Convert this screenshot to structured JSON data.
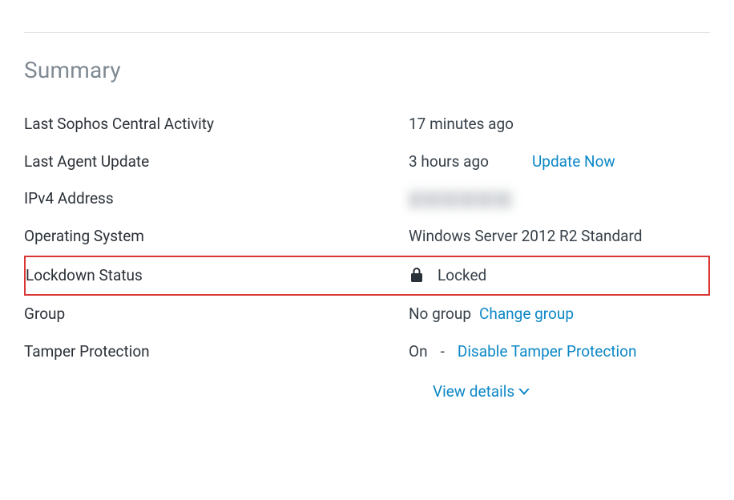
{
  "section_title": "Summary",
  "rows": {
    "activity": {
      "label": "Last Sophos Central Activity",
      "value": "17 minutes ago"
    },
    "agent_update": {
      "label": "Last Agent Update",
      "value": "3 hours ago",
      "action": "Update Now"
    },
    "ipv4": {
      "label": "IPv4 Address"
    },
    "os": {
      "label": "Operating System",
      "value": "Windows Server 2012 R2 Standard"
    },
    "lockdown": {
      "label": "Lockdown Status",
      "value": "Locked"
    },
    "group": {
      "label": "Group",
      "value": "No group",
      "action": "Change group"
    },
    "tamper": {
      "label": "Tamper Protection",
      "value": "On",
      "action": "Disable Tamper Protection",
      "separator": "-"
    }
  },
  "view_details": "View details"
}
